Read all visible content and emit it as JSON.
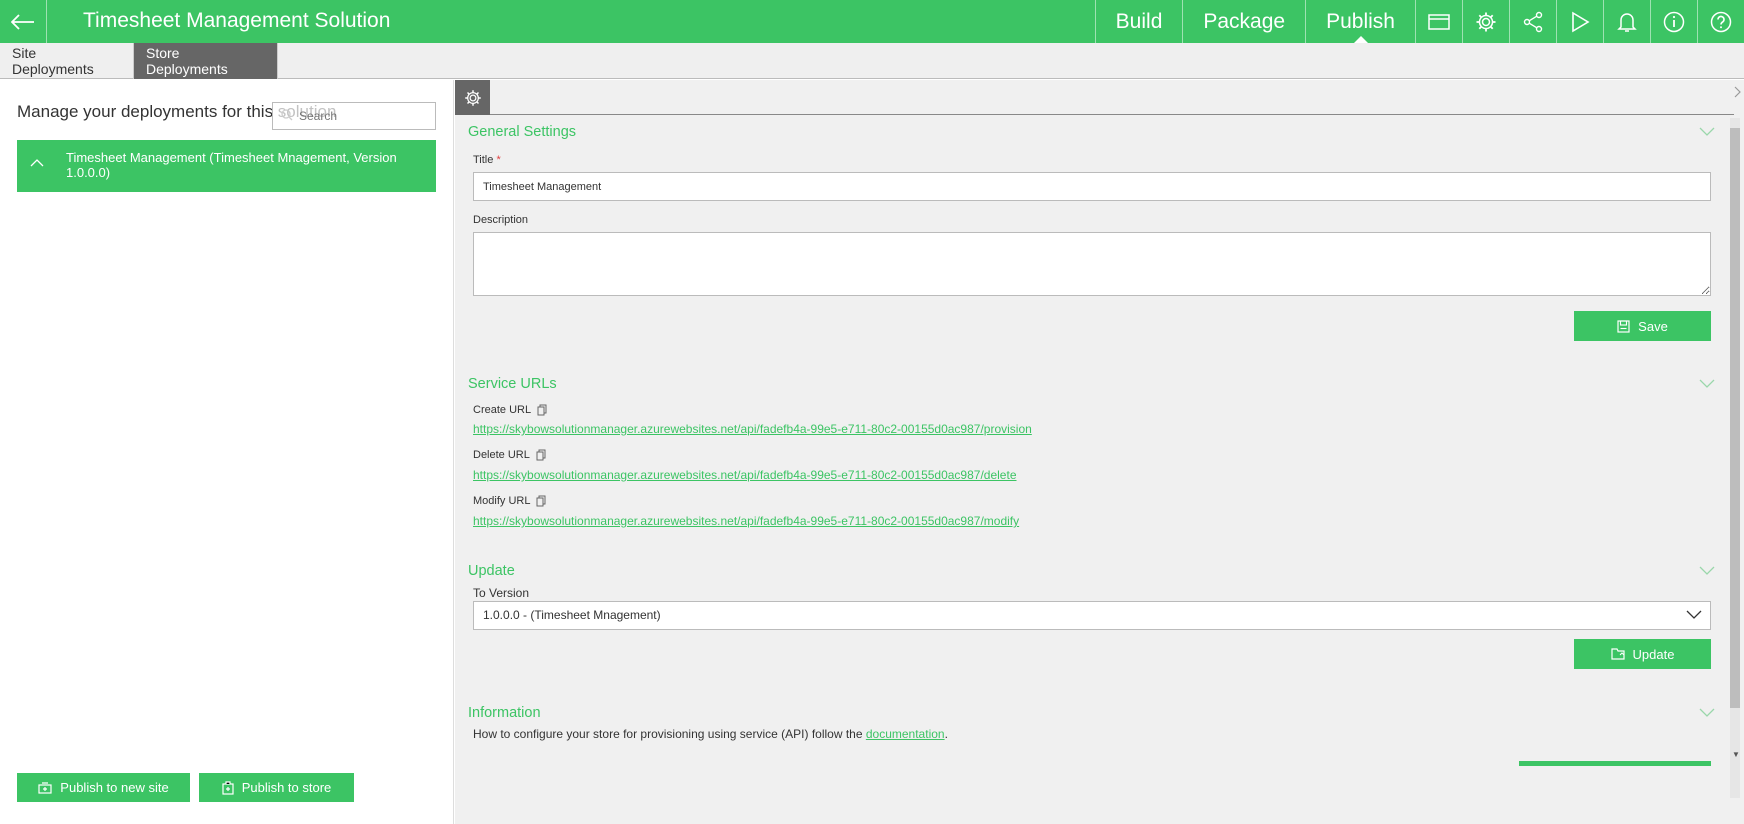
{
  "header": {
    "title": "Timesheet Management Solution",
    "nav": [
      {
        "label": "Build"
      },
      {
        "label": "Package"
      },
      {
        "label": "Publish",
        "active": true
      }
    ],
    "icons": [
      "card-icon",
      "gear-icon",
      "share-icon",
      "play-icon",
      "bell-icon",
      "info-icon",
      "help-icon"
    ]
  },
  "subtabs": [
    {
      "label": "Site Deployments",
      "active": false
    },
    {
      "label": "Store Deployments",
      "active": true
    }
  ],
  "left": {
    "heading": "Manage your deployments for this solution",
    "search_placeholder": "Search",
    "deployment_item": "Timesheet Management (Timesheet Mnagement, Version 1.0.0.0)",
    "publish_new_site": "Publish to new site",
    "publish_store": "Publish to store"
  },
  "general": {
    "title": "General Settings",
    "title_label": "Title",
    "required_mark": "*",
    "title_value": "Timesheet Management",
    "description_label": "Description",
    "description_value": "",
    "save_label": "Save"
  },
  "service": {
    "title": "Service URLs",
    "create_label": "Create URL",
    "create_url": "https://skybowsolutionmanager.azurewebsites.net/api/fadefb4a-99e5-e711-80c2-00155d0ac987/provision",
    "delete_label": "Delete URL",
    "delete_url": "https://skybowsolutionmanager.azurewebsites.net/api/fadefb4a-99e5-e711-80c2-00155d0ac987/delete",
    "modify_label": "Modify URL",
    "modify_url": "https://skybowsolutionmanager.azurewebsites.net/api/fadefb4a-99e5-e711-80c2-00155d0ac987/modify"
  },
  "update": {
    "title": "Update",
    "version_label": "To Version",
    "version_selected": "1.0.0.0 - (Timesheet Mnagement)",
    "update_label": "Update"
  },
  "information": {
    "title": "Information",
    "text": "How to configure your store for provisioning using service (API) follow the",
    "link": "documentation",
    "end": "."
  },
  "colors": {
    "accent": "#3cc464",
    "tab_active": "#666666"
  }
}
